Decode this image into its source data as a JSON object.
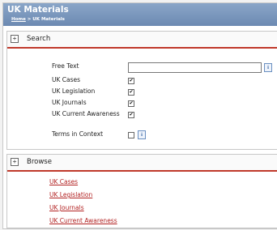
{
  "header": {
    "title": "UK Materials",
    "breadcrumb_home": "Home",
    "breadcrumb_separator": " > ",
    "breadcrumb_current": "UK Materials"
  },
  "search": {
    "toggle": "+",
    "title": "Search",
    "free_text_label": "Free Text",
    "free_text_value": "",
    "info_glyph": "i",
    "sources": [
      {
        "label": "UK Cases",
        "checked": true
      },
      {
        "label": "UK Legislation",
        "checked": true
      },
      {
        "label": "UK Journals",
        "checked": true
      },
      {
        "label": "UK Current Awareness",
        "checked": true
      }
    ],
    "terms_in_context_label": "Terms in Context",
    "terms_in_context_checked": false,
    "check_glyph": "✔"
  },
  "browse": {
    "toggle": "+",
    "title": "Browse",
    "links": [
      "UK Cases",
      "UK Legislation",
      "UK Journals",
      "UK Current Awareness"
    ]
  },
  "colors": {
    "header_blue": "#7a98bf",
    "accent_red": "#c0392b",
    "link_red": "#b22222"
  },
  "icons": {
    "expand": "expand-icon",
    "info": "info-icon",
    "checkmark": "checkmark-icon"
  }
}
